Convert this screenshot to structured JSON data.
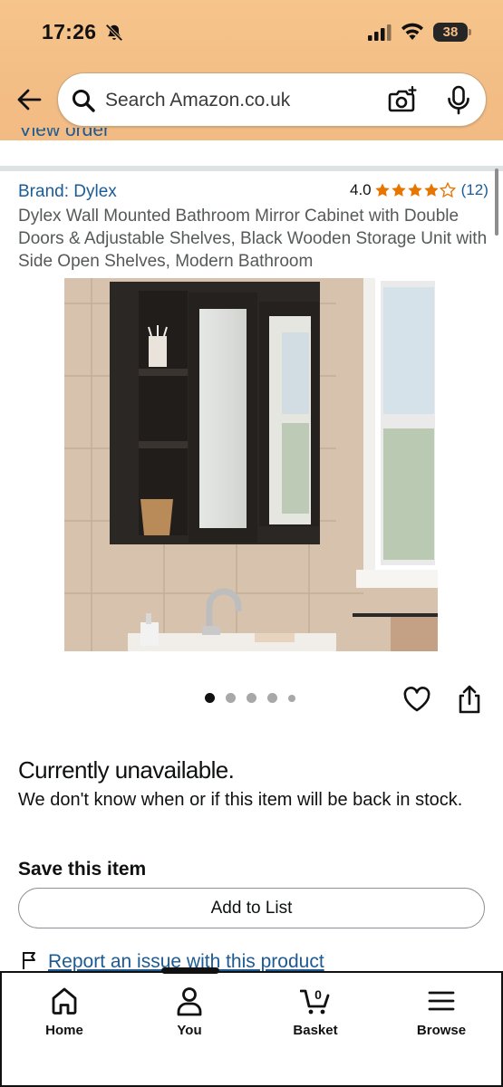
{
  "status_bar": {
    "time": "17:26",
    "battery": "38"
  },
  "search": {
    "placeholder": "Search Amazon.co.uk"
  },
  "prev_link": "View order",
  "product": {
    "brand": "Brand: Dylex",
    "rating_value": "4.0",
    "rating_stars": 4,
    "rating_count": "(12)",
    "title": "Dylex Wall Mounted Bathroom Mirror Cabinet with Double Doors & Adjustable Shelves, Black Wooden Storage Unit with Side Open Shelves, Modern Bathroom",
    "image_count": 5,
    "active_image": 1
  },
  "availability": {
    "heading": "Currently unavailable.",
    "message": "We don't know when or if this item will be back in stock."
  },
  "save": {
    "heading": "Save this item",
    "button_label": "Add to List"
  },
  "report": {
    "label": "Report an issue with this product"
  },
  "bottom_nav": {
    "items": [
      {
        "label": "Home",
        "icon": "home-icon"
      },
      {
        "label": "You",
        "icon": "person-icon"
      },
      {
        "label": "Basket",
        "icon": "basket-icon",
        "badge": "0"
      },
      {
        "label": "Browse",
        "icon": "menu-icon"
      }
    ]
  },
  "colors": {
    "header": "#f3bd86",
    "link": "#1a5c96",
    "star": "#e77600"
  }
}
